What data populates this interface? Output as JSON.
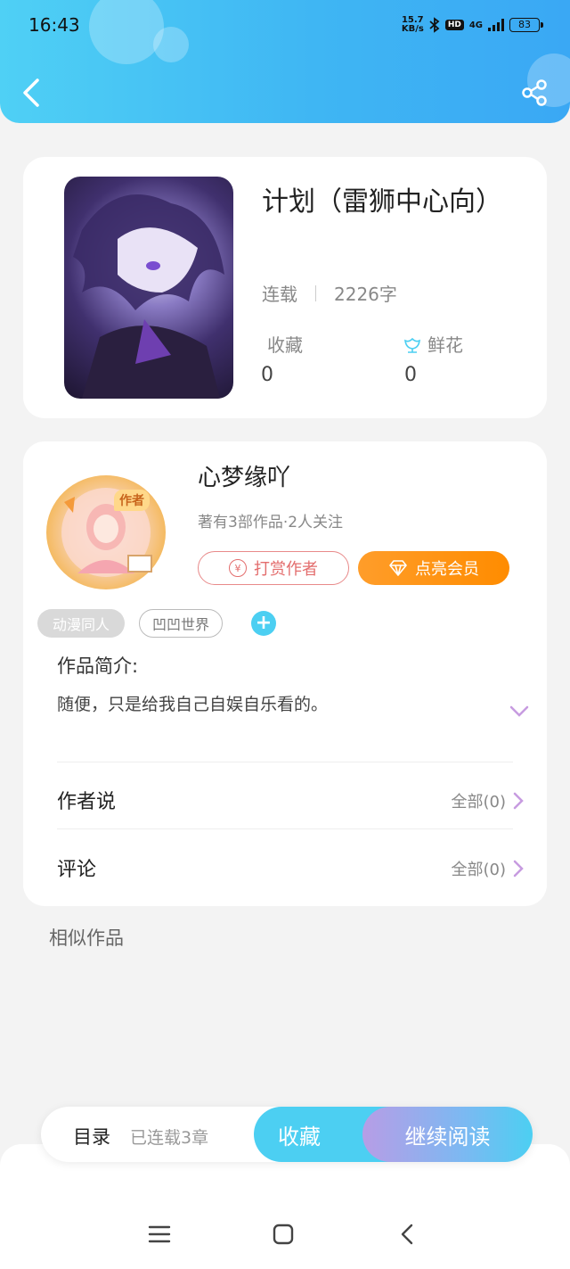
{
  "status_bar": {
    "time": "16:43",
    "net_speed_value": "15.7",
    "net_speed_unit": "KB/s",
    "hd": "HD",
    "network": "4G",
    "battery": "83"
  },
  "book": {
    "title": "计划（雷狮中心向）",
    "status": "连载",
    "word_count": "2226字",
    "collect_label": "收藏",
    "collect_count": "0",
    "flower_label": "鲜花",
    "flower_count": "0"
  },
  "author": {
    "avatar_tag": "作者",
    "name": "心梦缘吖",
    "info": "著有3部作品·2人关注",
    "tip_label": "打赏作者",
    "vip_label": "点亮会员"
  },
  "tags": [
    "动漫同人",
    "凹凹世界"
  ],
  "intro": {
    "label": "作品简介:",
    "text": "随便，只是给我自己自娱自乐看的。"
  },
  "rows": {
    "author_says": "作者说",
    "author_says_count": "全部(0)",
    "comments": "评论",
    "comments_count": "全部(0)"
  },
  "similar_label": "相似作品",
  "bottom": {
    "toc_label": "目录",
    "toc_count": "已连载3章",
    "fav_label": "收藏",
    "read_label": "继续阅读"
  },
  "colors": {
    "header_start": "#4fd0f5",
    "header_end": "#3aa8f4",
    "accent_cyan": "#4ccff2",
    "vip_orange": "#ff8c00",
    "tip_red": "#e36d6d"
  }
}
